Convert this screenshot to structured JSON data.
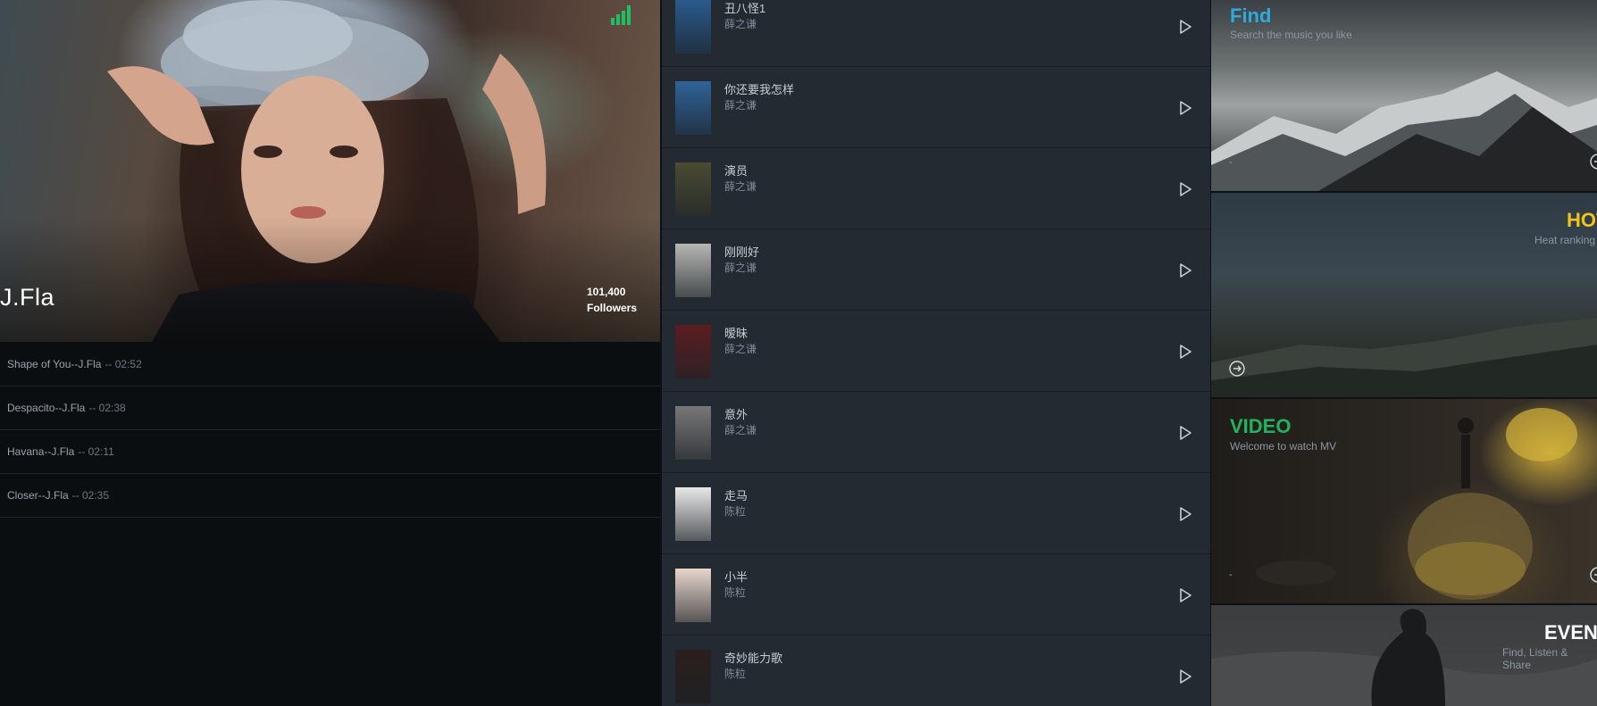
{
  "artist": {
    "name": "J.Fla",
    "followers_count": "101,400",
    "followers_label": "Followers",
    "tracks": [
      {
        "title": "Shape of You--J.Fla",
        "duration": "-- 02:52"
      },
      {
        "title": "Despacito--J.Fla",
        "duration": "-- 02:38"
      },
      {
        "title": "Havana--J.Fla",
        "duration": "-- 02:11"
      },
      {
        "title": "Closer--J.Fla",
        "duration": "-- 02:35"
      }
    ]
  },
  "songs": [
    {
      "title": "丑八怪1",
      "artist": "薛之谦",
      "cover": "#2a5a8c"
    },
    {
      "title": "你还要我怎样",
      "artist": "薛之谦",
      "cover": "#2f6399"
    },
    {
      "title": "演员",
      "artist": "薛之谦",
      "cover": "#4a4b33"
    },
    {
      "title": "刚刚好",
      "artist": "薛之谦",
      "cover": "#b5b7b3"
    },
    {
      "title": "暧昧",
      "artist": "薛之谦",
      "cover": "#5a1e22"
    },
    {
      "title": "意外",
      "artist": "薛之谦",
      "cover": "#777777"
    },
    {
      "title": "走马",
      "artist": "陈粒",
      "cover": "#e8e8e8"
    },
    {
      "title": "小半",
      "artist": "陈粒",
      "cover": "#e8d6cc"
    },
    {
      "title": "奇妙能力歌",
      "artist": "陈粒",
      "cover": "#2a1f1c"
    }
  ],
  "features": {
    "find": {
      "title": "Find",
      "subtitle": "Search the music you like",
      "dash": "-",
      "color": "#2eaadc"
    },
    "hot": {
      "title": "HOT",
      "subtitle": "Heat ranking",
      "color": "#f0c419"
    },
    "video": {
      "title": "VIDEO",
      "subtitle": "Welcome to watch MV",
      "dash": "-",
      "color": "#22b35e"
    },
    "event": {
      "title": "EVENT",
      "subtitle": "Find, Listen & Share",
      "color": "#ffffff"
    }
  },
  "icons": {
    "signal": "signal-bars-icon",
    "play": "play-icon",
    "circle_arrow": "circle-arrow-right-icon"
  }
}
